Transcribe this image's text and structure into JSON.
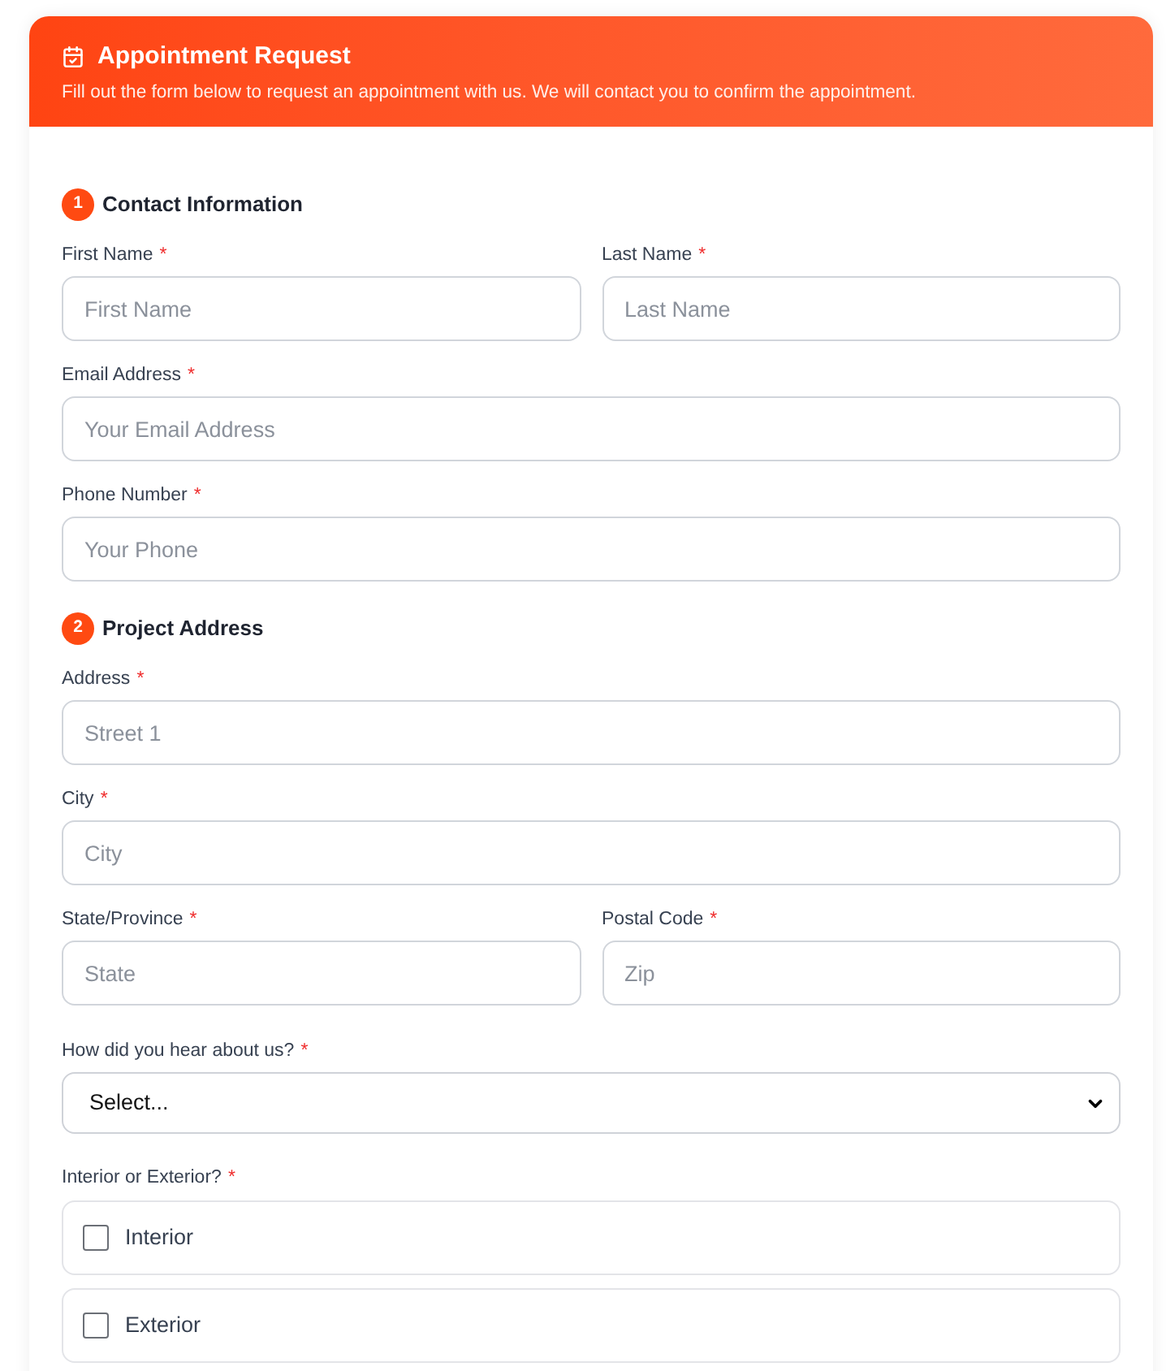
{
  "header": {
    "title": "Appointment Request",
    "subtitle": "Fill out the form below to request an appointment with us. We will contact you to confirm the appointment."
  },
  "sections": [
    {
      "number": "1",
      "title": "Contact Information",
      "rows": [
        [
          {
            "kind": "text",
            "label": "First Name",
            "required_mark": "*",
            "placeholder": "First Name"
          },
          {
            "kind": "text",
            "label": "Last Name",
            "required_mark": "*",
            "placeholder": "Last Name"
          }
        ],
        [
          {
            "kind": "text",
            "label": "Email Address",
            "required_mark": "*",
            "placeholder": "Your Email Address"
          }
        ],
        [
          {
            "kind": "text",
            "label": "Phone Number",
            "required_mark": "*",
            "placeholder": "Your Phone"
          }
        ]
      ]
    },
    {
      "number": "2",
      "title": "Project Address",
      "rows": [
        [
          {
            "kind": "text",
            "label": "Address",
            "required_mark": "*",
            "placeholder": "Street 1"
          }
        ],
        [
          {
            "kind": "text",
            "label": "City",
            "required_mark": "*",
            "placeholder": "City"
          }
        ],
        [
          {
            "kind": "text",
            "label": "State/Province",
            "required_mark": "*",
            "placeholder": "State"
          },
          {
            "kind": "text",
            "label": "Postal Code",
            "required_mark": "*",
            "placeholder": "Zip"
          }
        ],
        [
          {
            "kind": "select",
            "label": "How did you hear about us?",
            "required_mark": "*",
            "value": "Select..."
          }
        ],
        [
          {
            "kind": "checkbox_group",
            "label": "Interior or Exterior?",
            "required_mark": "*",
            "options": [
              {
                "label": "Interior",
                "checked": false
              },
              {
                "label": "Exterior",
                "checked": false
              }
            ]
          }
        ]
      ]
    }
  ]
}
